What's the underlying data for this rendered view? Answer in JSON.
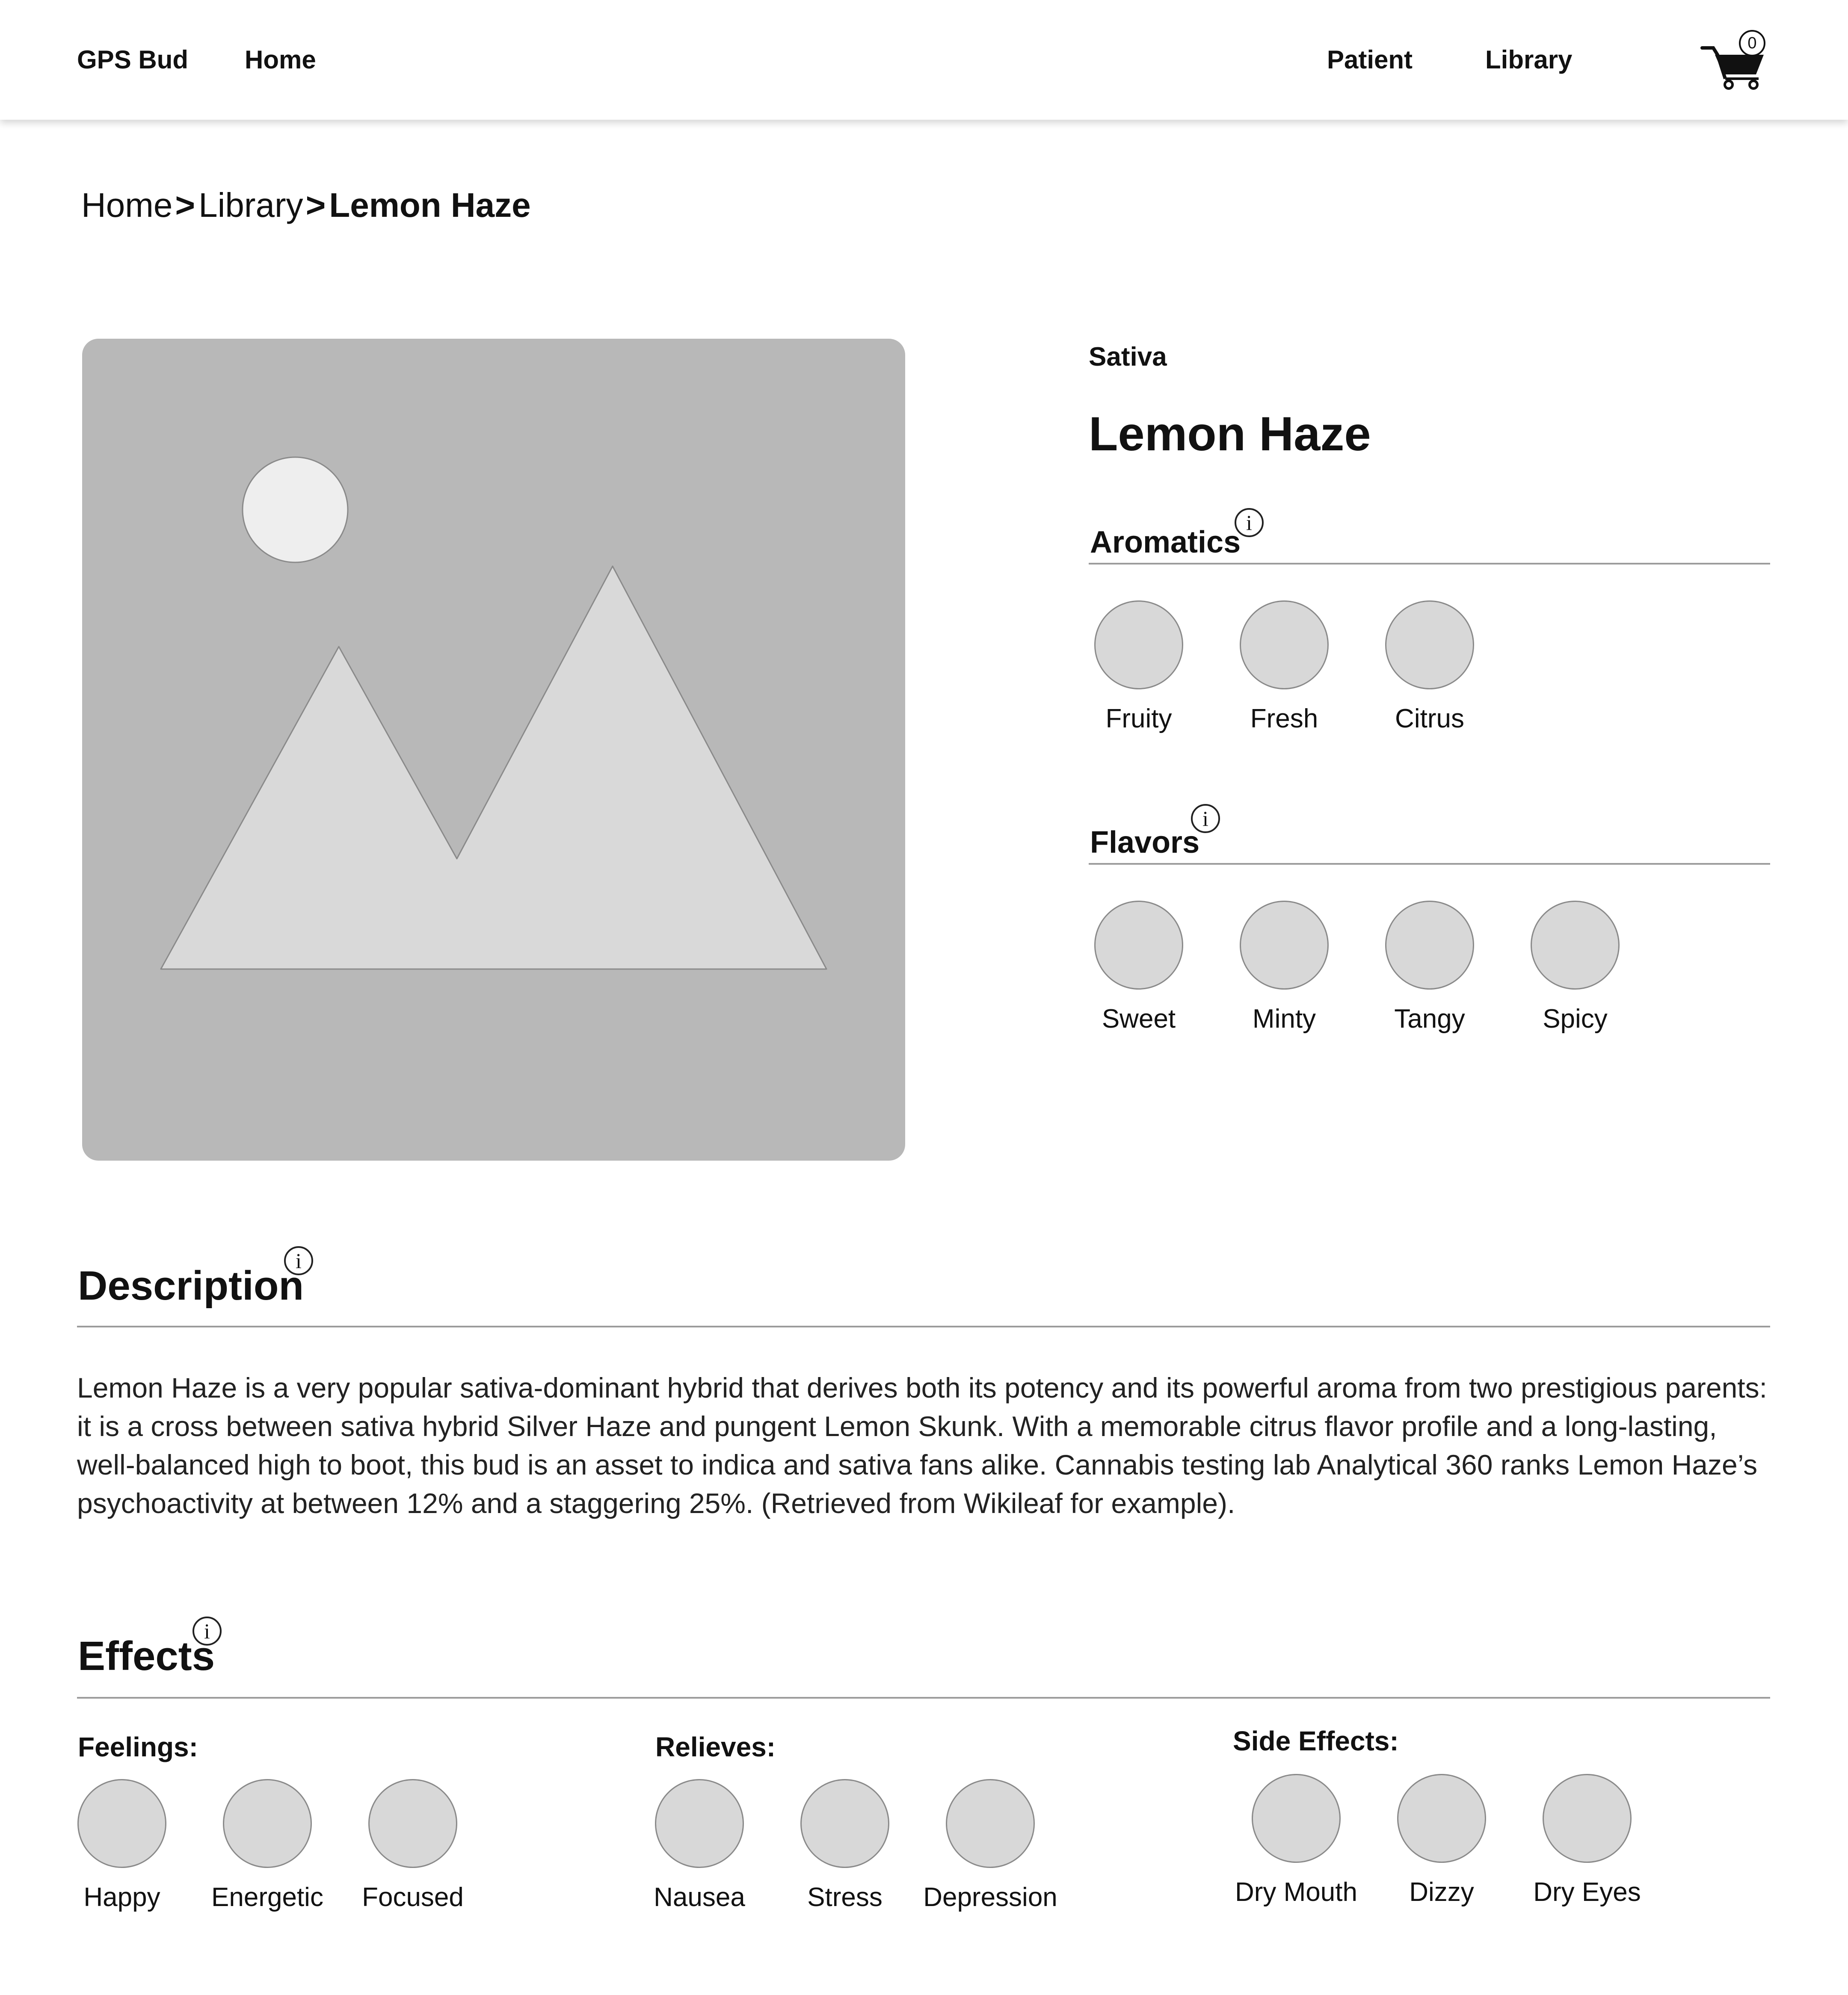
{
  "header": {
    "brand": "GPS Bud",
    "nav_home": "Home",
    "nav_patient": "Patient",
    "nav_library": "Library",
    "cart_count": "0"
  },
  "breadcrumb": {
    "home": "Home",
    "sep1": ">",
    "library": "Library",
    "sep2": ">",
    "current": "Lemon Haze"
  },
  "strain": {
    "type": "Sativa",
    "name": "Lemon Haze"
  },
  "aromatics": {
    "title": "Aromatics",
    "info": "i",
    "items": [
      "Fruity",
      "Fresh",
      "Citrus"
    ]
  },
  "flavors": {
    "title": "Flavors",
    "info": "i",
    "items": [
      "Sweet",
      "Minty",
      "Tangy",
      "Spicy"
    ]
  },
  "description": {
    "title": "Description",
    "info": "i",
    "text": "Lemon Haze is a very popular sativa-dominant hybrid that derives both its potency and its powerful aroma from two prestigious parents: it is a cross between sativa hybrid Silver Haze and pungent Lemon Skunk. With a memorable citrus flavor profile and a long-lasting, well-balanced high to boot, this bud is an asset to indica and sativa fans alike. Cannabis testing lab Analytical 360 ranks Lemon Haze’s psychoactivity at between 12% and a staggering 25%. (Retrieved from Wikileaf for example)."
  },
  "effects": {
    "title": "Effects",
    "info": "i",
    "feelings": {
      "title": "Feelings:",
      "items": [
        "Happy",
        "Energetic",
        "Focused"
      ]
    },
    "relieves": {
      "title": "Relieves:",
      "items": [
        "Nausea",
        "Stress",
        "Depression"
      ]
    },
    "side_effects": {
      "title": "Side Effects:",
      "items": [
        "Dry Mouth",
        "Dizzy",
        "Dry Eyes"
      ]
    }
  },
  "colors": {
    "chip_fill": "#d8d8d8",
    "placeholder": "#b8b8b8",
    "divider": "#9c9c9c"
  }
}
